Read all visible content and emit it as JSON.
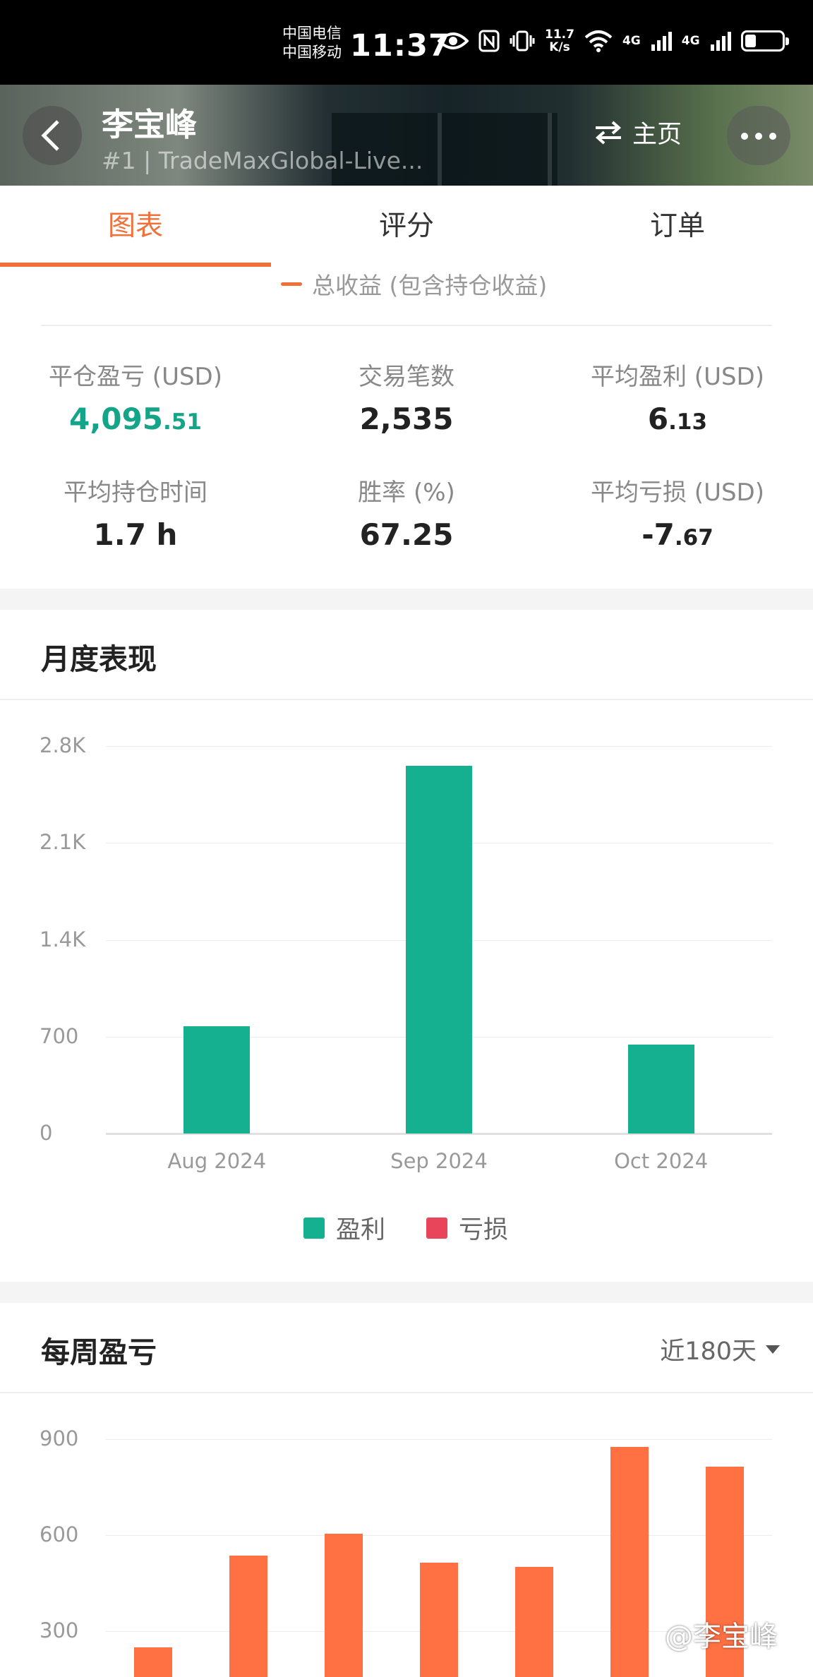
{
  "status_bar": {
    "carrier_1": "中国电信",
    "carrier_2": "中国移动",
    "time": "11:37",
    "net_speed_value": "11.7",
    "net_speed_unit": "K/s",
    "network_1": "4G",
    "network_2": "4G",
    "battery_level": 0.3
  },
  "header": {
    "name": "李宝峰",
    "account": "#1 | TradeMaxGlobal-Live...",
    "home_label": "主页"
  },
  "tabs": [
    {
      "label": "图表",
      "active": true
    },
    {
      "label": "评分",
      "active": false
    },
    {
      "label": "订单",
      "active": false
    }
  ],
  "stats": {
    "legend_partial": "总收益 (包含持仓收益)",
    "items": [
      {
        "label": "平仓盈亏 (USD)",
        "value_main": "4,095",
        "value_small": ".51",
        "color": "#14a589"
      },
      {
        "label": "交易笔数",
        "value_main": "2,535",
        "value_small": ""
      },
      {
        "label": "平均盈利 (USD)",
        "value_main": "6",
        "value_small": ".13"
      },
      {
        "label": "平均持仓时间",
        "value_main": "1.7 h",
        "value_small": ""
      },
      {
        "label": "胜率 (%)",
        "value_main": "67.25",
        "value_small": ""
      },
      {
        "label": "平均亏损 (USD)",
        "value_main": "-7",
        "value_small": ".67"
      }
    ]
  },
  "monthly": {
    "title": "月度表现",
    "chart_data": {
      "type": "bar",
      "categories": [
        "Aug 2024",
        "Sep 2024",
        "Oct 2024"
      ],
      "series": [
        {
          "name": "盈利",
          "color": "#14b08f",
          "values": [
            775,
            2655,
            645
          ]
        },
        {
          "name": "亏损",
          "color": "#e8445a",
          "values": [
            0,
            0,
            0
          ]
        }
      ],
      "y_ticks": [
        "0",
        "700",
        "1.4K",
        "2.1K",
        "2.8K"
      ],
      "ylim": [
        0,
        2800
      ],
      "grid": true,
      "legend": "bottom-center"
    }
  },
  "weekly": {
    "title": "每周盈亏",
    "range_label": "近180天",
    "chart_data": {
      "type": "bar",
      "color": "#ff7043",
      "values": [
        250,
        535,
        605,
        515,
        500,
        875,
        815
      ],
      "y_ticks": [
        "300",
        "600",
        "900"
      ],
      "ylim": [
        0,
        900
      ],
      "grid": true
    }
  },
  "watermark": "@李宝峰"
}
